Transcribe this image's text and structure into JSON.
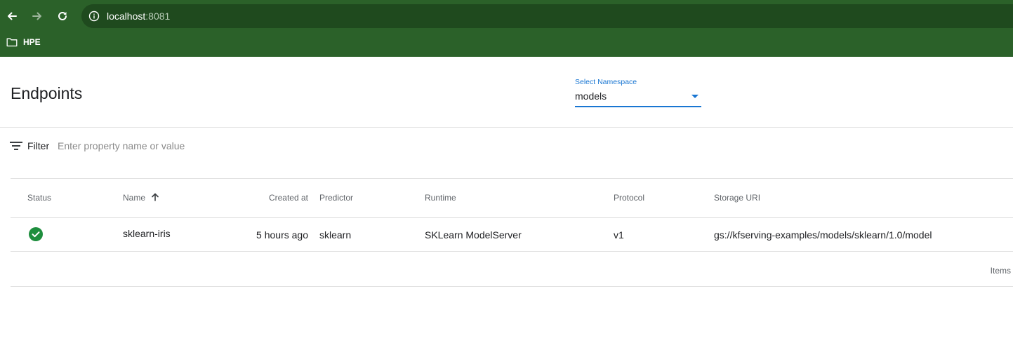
{
  "browser": {
    "url_host": "localhost",
    "url_port": ":8081",
    "bookmark_label": "HPE"
  },
  "page": {
    "title": "Endpoints"
  },
  "namespace": {
    "label": "Select Namespace",
    "value": "models"
  },
  "filter": {
    "label": "Filter",
    "placeholder": "Enter property name or value"
  },
  "table": {
    "headers": {
      "status": "Status",
      "name": "Name",
      "created": "Created at",
      "predictor": "Predictor",
      "runtime": "Runtime",
      "protocol": "Protocol",
      "storage": "Storage URI"
    },
    "rows": [
      {
        "status": "ready",
        "name": "sklearn-iris",
        "created": "5 hours ago",
        "predictor": "sklearn",
        "runtime": "SKLearn ModelServer",
        "protocol": "v1",
        "storage": "gs://kfserving-examples/models/sklearn/1.0/model"
      }
    ],
    "footer_label": "Items"
  },
  "colors": {
    "chrome_green": "#2b6129",
    "accent_blue": "#1976d2",
    "status_green": "#1e8e3e"
  },
  "icons": {
    "back": "arrow-left-icon",
    "forward": "arrow-right-icon",
    "reload": "reload-icon",
    "info": "info-icon",
    "folder": "folder-icon",
    "filter": "filter-icon",
    "sort": "arrow-up-icon",
    "status": "check-circle-icon"
  }
}
